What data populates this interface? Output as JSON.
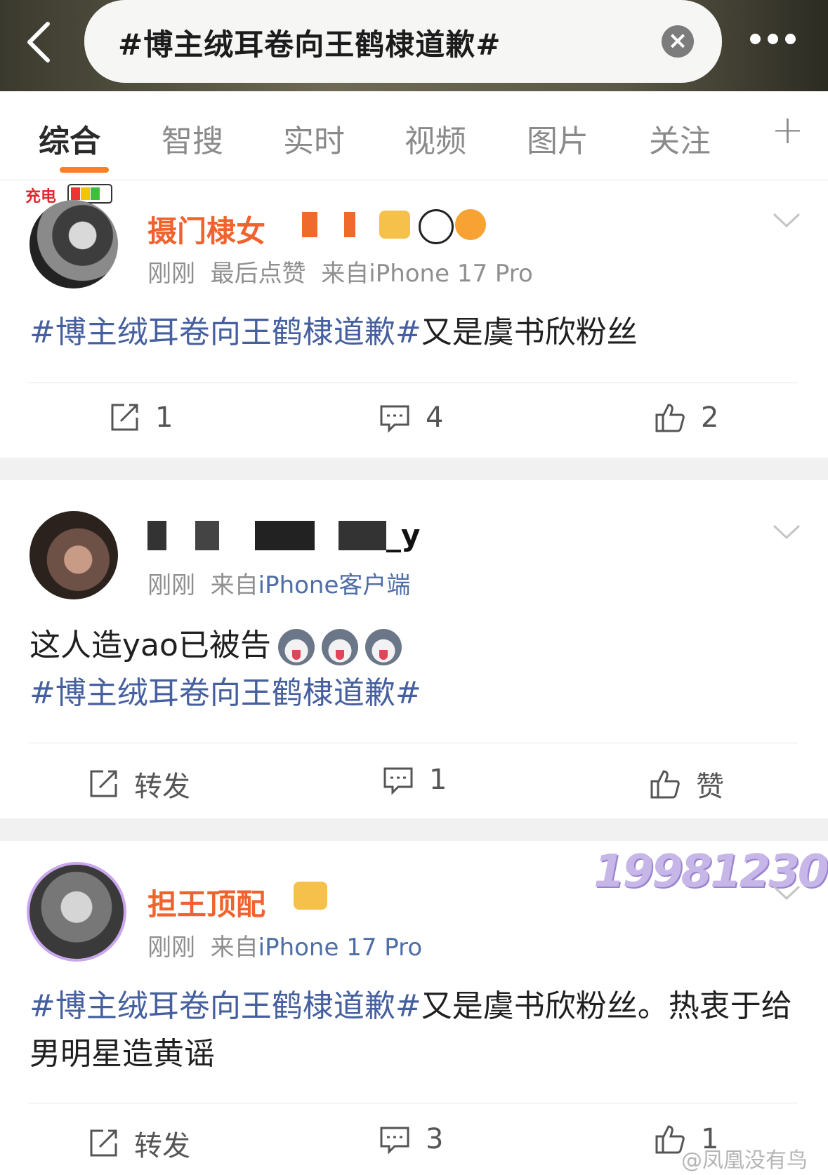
{
  "search": {
    "query": "#博主绒耳卷向王鹤棣道歉#",
    "clear_label": "×"
  },
  "tabs": [
    {
      "label": "综合",
      "active": true
    },
    {
      "label": "智搜"
    },
    {
      "label": "实时"
    },
    {
      "label": "视频"
    },
    {
      "label": "图片"
    },
    {
      "label": "关注"
    }
  ],
  "tab_plus": "+",
  "status": {
    "charging_label": "充电"
  },
  "posts": [
    {
      "username": "摄门棣女",
      "time": "刚刚",
      "extra": "最后点赞",
      "source": "来自iPhone 17 Pro",
      "hashtag": "#博主绒耳卷向王鹤棣道歉#",
      "text": "又是虞书欣粉丝",
      "repost": "1",
      "comment": "4",
      "like": "2"
    },
    {
      "username": "_y",
      "time": "刚刚",
      "source_prefix": "来自",
      "source": "iPhone客户端",
      "text": "这人造yao已被告",
      "hashtag": "#博主绒耳卷向王鹤棣道歉#",
      "repost": "转发",
      "comment": "1",
      "like": "赞"
    },
    {
      "username": "担王顶配",
      "badge_number": "19981230",
      "time": "刚刚",
      "source_prefix": "来自",
      "source": "iPhone 17 Pro",
      "hashtag": "#博主绒耳卷向王鹤棣道歉#",
      "text": "又是虞书欣粉丝。热衷于给男明星造黄谣",
      "repost": "转发",
      "comment": "3",
      "like": "1"
    }
  ],
  "watermark": "@凤凰没有鸟",
  "colors": {
    "tag": "#46609f",
    "accent": "#ff7e1d",
    "username": "#f2622e"
  }
}
